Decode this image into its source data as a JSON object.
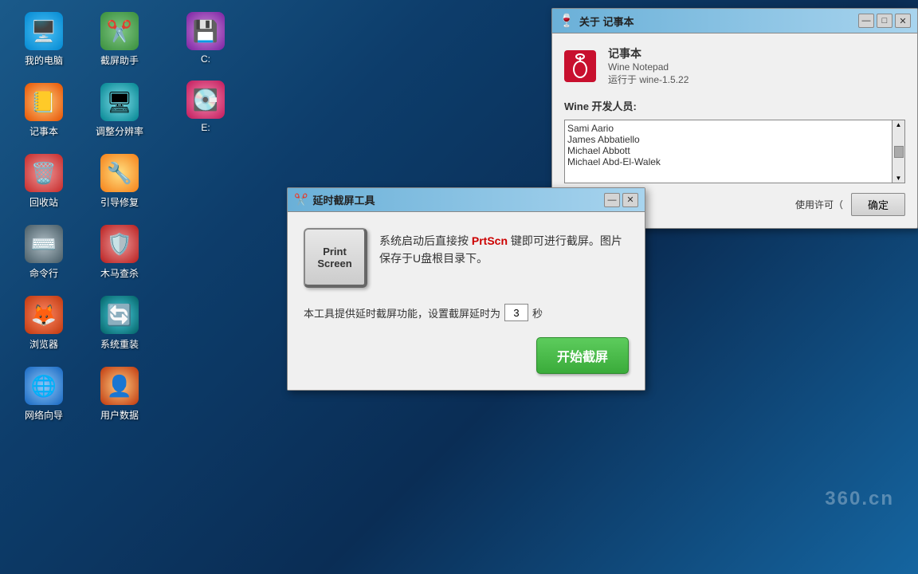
{
  "desktop": {
    "icons": [
      {
        "id": "my-computer",
        "label": "我的电脑",
        "emoji": "🖥️",
        "colorClass": "icon-pc"
      },
      {
        "id": "screenshot",
        "label": "截屏助手",
        "emoji": "✂️",
        "colorClass": "icon-screenshot"
      },
      {
        "id": "disk-c",
        "label": "C:",
        "emoji": "💾",
        "colorClass": "icon-disk-c"
      },
      {
        "id": "notepad",
        "label": "记事本",
        "emoji": "📒",
        "colorClass": "icon-notepad"
      },
      {
        "id": "resolution",
        "label": "调整分辨率",
        "emoji": "🖥",
        "colorClass": "icon-resolution"
      },
      {
        "id": "disk-e",
        "label": "E:",
        "emoji": "💽",
        "colorClass": "icon-disk-e"
      },
      {
        "id": "trash",
        "label": "回收站",
        "emoji": "🗑️",
        "colorClass": "icon-trash"
      },
      {
        "id": "repair",
        "label": "引导修复",
        "emoji": "🔧",
        "colorClass": "icon-repair"
      },
      {
        "id": "cmd",
        "label": "命令行",
        "emoji": "⌨️",
        "colorClass": "icon-cmd"
      },
      {
        "id": "virus",
        "label": "木马查杀",
        "emoji": "🛡️",
        "colorClass": "icon-virus"
      },
      {
        "id": "browser",
        "label": "浏览器",
        "emoji": "🦊",
        "colorClass": "icon-browser"
      },
      {
        "id": "reinstall",
        "label": "系统重装",
        "emoji": "🔄",
        "colorClass": "icon-reinstall"
      },
      {
        "id": "network",
        "label": "网络向导",
        "emoji": "🌐",
        "colorClass": "icon-network"
      },
      {
        "id": "userdata",
        "label": "用户数据",
        "emoji": "👤",
        "colorClass": "icon-userdata"
      }
    ]
  },
  "tool_dialog": {
    "title": "延时截屏工具",
    "title_icon": "✂️",
    "minimize_label": "—",
    "close_label": "✕",
    "printscreen_line1": "Print",
    "printscreen_line2": "Screen",
    "info_text_before": "系统启动后直接按 ",
    "info_highlight": "PrtScn",
    "info_text_after": " 键即可进行截屏。图片保存于U盘根目录下。",
    "delay_text_before": "本工具提供延时截屏功能，设置截屏延时为",
    "delay_value": "3",
    "delay_text_after": "秒",
    "start_button_label": "开始截屏"
  },
  "about_dialog": {
    "title": "关于 记事本",
    "title_icon": "🍷",
    "app_name": "记事本",
    "app_subname": "Wine Notepad",
    "app_version": "运行于 wine-1.5.22",
    "developers_title": "Wine 开发人员:",
    "developers": [
      "Sami Aario",
      "James Abbatiello",
      "Michael Abbott",
      "Michael Abd-El-Walek"
    ],
    "license_label": "使用许可（",
    "ok_label": "确定"
  },
  "watermark": {
    "text": "360.cn"
  }
}
